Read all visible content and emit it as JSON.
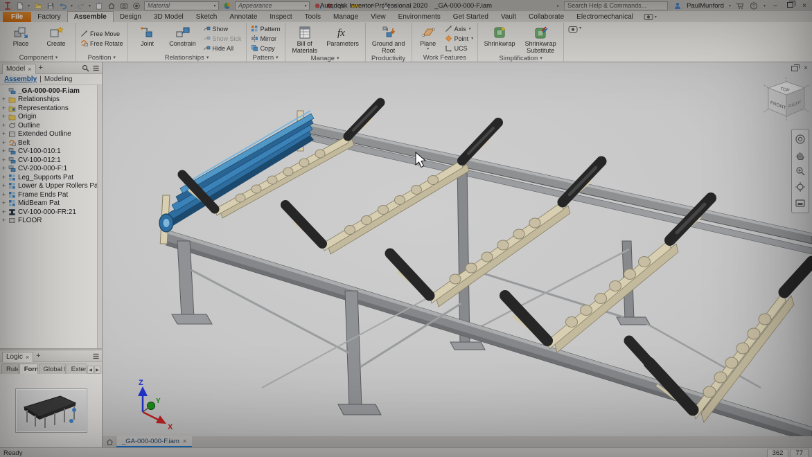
{
  "titlebar": {
    "app_title": "Autodesk Inventor Professional 2020",
    "doc_title": "_GA-000-000-F.iam",
    "search_placeholder": "Search Help & Commands...",
    "user": "PaulMunford",
    "material_label": "Material",
    "appearance_label": "Appearance"
  },
  "tabs": [
    {
      "label": "File"
    },
    {
      "label": "Factory"
    },
    {
      "label": "Assemble"
    },
    {
      "label": "Design"
    },
    {
      "label": "3D Model"
    },
    {
      "label": "Sketch"
    },
    {
      "label": "Annotate"
    },
    {
      "label": "Inspect"
    },
    {
      "label": "Tools"
    },
    {
      "label": "Manage"
    },
    {
      "label": "View"
    },
    {
      "label": "Environments"
    },
    {
      "label": "Get Started"
    },
    {
      "label": "Vault"
    },
    {
      "label": "Collaborate"
    },
    {
      "label": "Electromechanical"
    }
  ],
  "ribbon": {
    "groups": [
      {
        "label": "Component",
        "buttons": [
          {
            "label": "Place"
          },
          {
            "label": "Create"
          }
        ]
      },
      {
        "label": "Position",
        "buttons": [
          {
            "label": "Free Move"
          },
          {
            "label": "Free Rotate"
          }
        ]
      },
      {
        "label": "Relationships",
        "buttons": [
          {
            "label": "Joint"
          },
          {
            "label": "Constrain"
          },
          {
            "label": "Show"
          },
          {
            "label": "Show Sick"
          },
          {
            "label": "Hide All"
          }
        ]
      },
      {
        "label": "Pattern",
        "buttons": [
          {
            "label": "Pattern"
          },
          {
            "label": "Mirror"
          },
          {
            "label": "Copy"
          }
        ]
      },
      {
        "label": "Manage",
        "buttons": [
          {
            "label": "Bill of Materials"
          },
          {
            "label": "Parameters"
          }
        ]
      },
      {
        "label": "Productivity",
        "buttons": [
          {
            "label": "Ground and Root"
          }
        ]
      },
      {
        "label": "Work Features",
        "buttons": [
          {
            "label": "Plane"
          },
          {
            "label": "Axis"
          },
          {
            "label": "Point"
          },
          {
            "label": "UCS"
          }
        ]
      },
      {
        "label": "Simplification",
        "buttons": [
          {
            "label": "Shrinkwrap"
          },
          {
            "label": "Shrinkwrap Substitute"
          }
        ]
      }
    ]
  },
  "browser": {
    "panel_tab": "Model",
    "close_glyph": "×",
    "add_glyph": "+",
    "expander": "+",
    "views": [
      {
        "label": "Assembly"
      },
      {
        "label": "Modeling"
      }
    ],
    "views_sep": "|",
    "tree": [
      {
        "label": "_GA-000-000-F.iam"
      },
      {
        "label": "Relationships"
      },
      {
        "label": "Representations"
      },
      {
        "label": "Origin"
      },
      {
        "label": "Outline"
      },
      {
        "label": "Extended Outline"
      },
      {
        "label": "Belt"
      },
      {
        "label": "CV-100-010:1"
      },
      {
        "label": "CV-100-012:1"
      },
      {
        "label": "CV-200-000-F:1"
      },
      {
        "label": "Leg_Supports Pat"
      },
      {
        "label": "Lower & Upper Rollers Pat"
      },
      {
        "label": "Frame Ends Pat"
      },
      {
        "label": "MidBeam Pat"
      },
      {
        "label": "CV-100-000-FR:21"
      },
      {
        "label": "FLOOR"
      }
    ]
  },
  "logic": {
    "panel_tab": "Logic",
    "close_glyph": "×",
    "add_glyph": "+",
    "tabs": [
      {
        "label": "Rules"
      },
      {
        "label": "Forms"
      },
      {
        "label": "Global Forms"
      },
      {
        "label": "External"
      }
    ],
    "scroll_left": "◀",
    "scroll_right": "▶"
  },
  "viewport": {
    "viewcube": {
      "top": "TOP",
      "front": "FRONT",
      "right": "RIGHT"
    },
    "triad": {
      "x": "X",
      "y": "Y",
      "z": "Z"
    },
    "doc_tab": {
      "label": "_GA-000-000-F.iam",
      "close": "×"
    }
  },
  "statusbar": {
    "message": "Ready",
    "count_occurrences": "362",
    "count_open": "77"
  },
  "colors": {
    "accent_blue": "#1a72c8",
    "file_tab_orange": "#cd6f18",
    "belt_blue": "#3a82b8",
    "steel_gray": "#8e9092",
    "cream": "#d8cfb2",
    "roller_black": "#262626"
  }
}
